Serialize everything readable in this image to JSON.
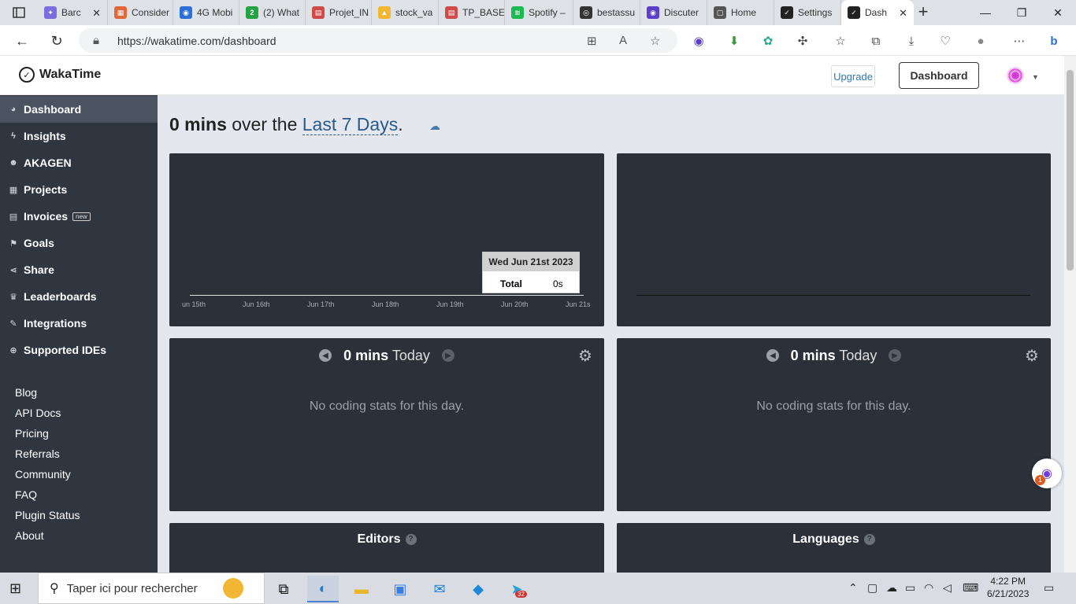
{
  "browser": {
    "tabs": [
      {
        "title": "Barc",
        "color": "#7a6de0",
        "glyph": "✦"
      },
      {
        "title": "Consider",
        "color": "#e2683c",
        "glyph": "▦"
      },
      {
        "title": "4G Mobi",
        "color": "#2b6fd6",
        "glyph": "◉"
      },
      {
        "title": "(2) What",
        "color": "#25a244",
        "glyph": "2"
      },
      {
        "title": "Projet_IN",
        "color": "#d04a4a",
        "glyph": "▤"
      },
      {
        "title": "stock_va",
        "color": "#f2b632",
        "glyph": "▲"
      },
      {
        "title": "TP_BASE",
        "color": "#d04a4a",
        "glyph": "▤"
      },
      {
        "title": "Spotify –",
        "color": "#1db954",
        "glyph": "≋"
      },
      {
        "title": "bestassu",
        "color": "#333333",
        "glyph": "◎"
      },
      {
        "title": "Discuter",
        "color": "#5b3ec9",
        "glyph": "◉"
      },
      {
        "title": "Home",
        "color": "#555555",
        "glyph": "▢"
      },
      {
        "title": "Settings",
        "color": "#222222",
        "glyph": "✓"
      },
      {
        "title": "Dash",
        "color": "#222222",
        "glyph": "✓"
      }
    ],
    "url": "https://wakatime.com/dashboard"
  },
  "header": {
    "logo_text": "WakaTime",
    "upgrade_label": "Upgrade",
    "dashboard_label": "Dashboard"
  },
  "sidebar": {
    "nav": [
      {
        "label": "Dashboard",
        "icon": "◕"
      },
      {
        "label": "Insights",
        "icon": "ϟ"
      },
      {
        "label": "AKAGEN",
        "icon": "☻"
      },
      {
        "label": "Projects",
        "icon": "▦"
      },
      {
        "label": "Invoices",
        "icon": "▤"
      },
      {
        "label": "Goals",
        "icon": "⚑"
      },
      {
        "label": "Share",
        "icon": "⋖"
      },
      {
        "label": "Leaderboards",
        "icon": "♛"
      },
      {
        "label": "Integrations",
        "icon": "✎"
      },
      {
        "label": "Supported IDEs",
        "icon": "⊕"
      }
    ],
    "invoices_badge": "new",
    "links": [
      "Blog",
      "API Docs",
      "Pricing",
      "Referrals",
      "Community",
      "FAQ",
      "Plugin Status",
      "About"
    ]
  },
  "main": {
    "headline_amount": "0 mins",
    "headline_mid": "over the",
    "headline_range": "Last 7 Days",
    "headline_end": ".",
    "chart_tooltip": {
      "date": "Wed Jun 21st 2023",
      "label": "Total",
      "value": "0s"
    },
    "chart_ticks": [
      "un 15th",
      "Jun 16th",
      "Jun 17th",
      "Jun 18th",
      "Jun 19th",
      "Jun 20th",
      "Jun 21s"
    ],
    "day_panels": [
      {
        "amount": "0 mins",
        "period": "Today",
        "empty": "No coding stats for this day."
      },
      {
        "amount": "0 mins",
        "period": "Today",
        "empty": "No coding stats for this day."
      }
    ],
    "editors_title": "Editors",
    "languages_title": "Languages"
  },
  "taskbar": {
    "search_placeholder": "Taper ici pour rechercher",
    "time": "4:22 PM",
    "date": "6/21/2023",
    "telegram_badge": "32"
  }
}
